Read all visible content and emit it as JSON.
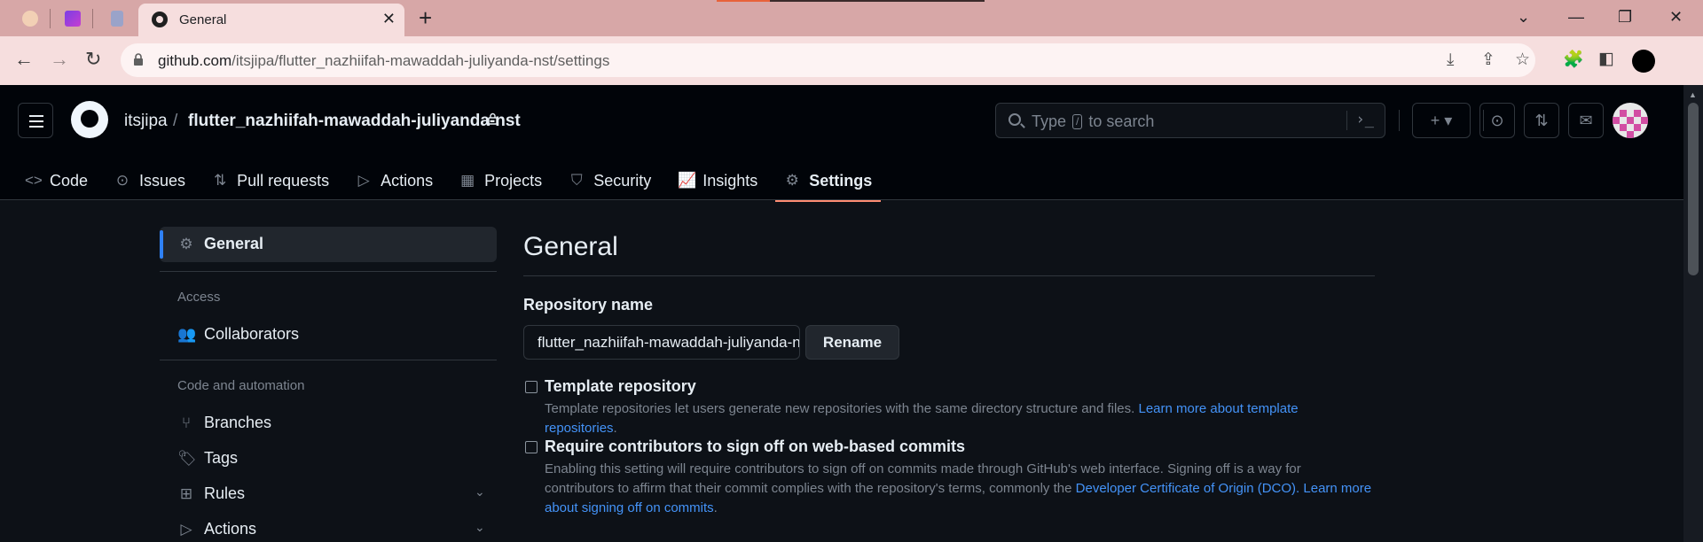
{
  "browser": {
    "active_tab_title": "General",
    "tab_close": "✕",
    "new_tab": "+",
    "window_controls": [
      "⌄",
      "—",
      "❐",
      "✕"
    ],
    "url_host": "github.com",
    "url_path": "/itsjipa/flutter_nazhiifah-mawaddah-juliyanda-nst/settings",
    "nav": {
      "back": "←",
      "forward": "→",
      "reload": "↻"
    }
  },
  "header": {
    "owner": "itsjipa",
    "slash": "/",
    "repo": "flutter_nazhiifah-mawaddah-juliyanda-nst",
    "search_prefix": "Type",
    "search_key": "/",
    "search_suffix": "to search",
    "command_icon": "›_",
    "plus": "+ ▾"
  },
  "repo_nav": [
    {
      "label": "Code",
      "icon": "code-icon",
      "glyph": "<>"
    },
    {
      "label": "Issues",
      "icon": "issue-icon",
      "glyph": "⊙"
    },
    {
      "label": "Pull requests",
      "icon": "pull-request-icon",
      "glyph": "⇅"
    },
    {
      "label": "Actions",
      "icon": "play-icon",
      "glyph": "▷"
    },
    {
      "label": "Projects",
      "icon": "table-icon",
      "glyph": "▦"
    },
    {
      "label": "Security",
      "icon": "shield-icon",
      "glyph": "⛉"
    },
    {
      "label": "Insights",
      "icon": "graph-icon",
      "glyph": "📈"
    },
    {
      "label": "Settings",
      "icon": "gear-icon",
      "glyph": "⚙"
    }
  ],
  "sidebar": {
    "active": {
      "label": "General",
      "glyph": "⚙"
    },
    "access_heading": "Access",
    "collaborators": {
      "label": "Collaborators",
      "glyph": "👥"
    },
    "code_heading": "Code and automation",
    "branches": {
      "label": "Branches",
      "glyph": "⑂"
    },
    "tags": {
      "label": "Tags",
      "glyph": "🏷"
    },
    "rules": {
      "label": "Rules",
      "glyph": "⊞"
    },
    "actions": {
      "label": "Actions",
      "glyph": "▷"
    },
    "chevron": "⌄"
  },
  "main": {
    "title": "General",
    "repo_name_label": "Repository name",
    "repo_name_value": "flutter_nazhiifah-mawaddah-juliyanda-nst",
    "rename_label": "Rename",
    "template": {
      "title": "Template repository",
      "desc": "Template repositories let users generate new repositories with the same directory structure and files.",
      "link": "Learn more about template repositories",
      "end": "."
    },
    "signoff": {
      "title": "Require contributors to sign off on web-based commits",
      "desc": "Enabling this setting will require contributors to sign off on commits made through GitHub's web interface. Signing off is a way for contributors to affirm that their commit complies with the repository's terms, commonly the",
      "link1": "Developer Certificate of Origin (DCO).",
      "link2": "Learn more about signing off on commits",
      "end": "."
    }
  },
  "colors": {
    "accent_underline": "#fd8c73",
    "link": "#4493f8",
    "sidebar_active_bar": "#2f81f7",
    "chrome_tabstrip": "#d7a7a7"
  }
}
